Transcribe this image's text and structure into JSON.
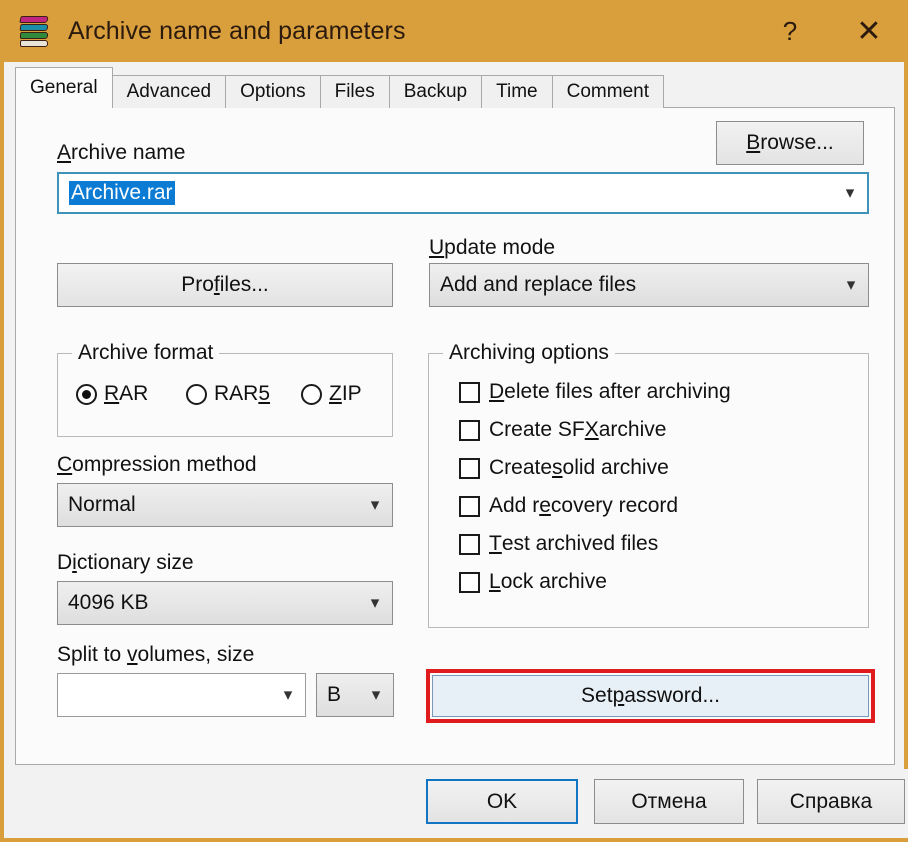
{
  "window": {
    "title": "Archive name and parameters",
    "icon": "winrar-books-icon",
    "help_button": "?",
    "close_button": "✕",
    "titlebar_color": "#d89f3c"
  },
  "tabs": [
    {
      "label": "General",
      "active": true
    },
    {
      "label": "Advanced",
      "active": false
    },
    {
      "label": "Options",
      "active": false
    },
    {
      "label": "Files",
      "active": false
    },
    {
      "label": "Backup",
      "active": false
    },
    {
      "label": "Time",
      "active": false
    },
    {
      "label": "Comment",
      "active": false
    }
  ],
  "general": {
    "archive_name": {
      "label_pre": "A",
      "label_post": "rchive name",
      "value": "Archive.rar",
      "selected": true,
      "focused": true
    },
    "browse_button": {
      "label_pre": "B",
      "label_post": "rowse..."
    },
    "profiles_button": {
      "label_pre_a": "Pro",
      "label_acc": "f",
      "label_post": "iles..."
    },
    "update_mode": {
      "label_pre": "U",
      "label_post": "pdate mode",
      "value": "Add and replace files"
    },
    "archive_format": {
      "legend": "Archive format",
      "options": [
        {
          "label_acc": "R",
          "label_post": "AR",
          "label_pre": "",
          "selected": true
        },
        {
          "label_acc": "5",
          "label_post": "",
          "label_pre": "RAR",
          "selected": false
        },
        {
          "label_acc": "Z",
          "label_post": "IP",
          "label_pre": "",
          "selected": false
        }
      ]
    },
    "compression_method": {
      "label_pre": "C",
      "label_post": "ompression method",
      "value": "Normal"
    },
    "dictionary_size": {
      "label_pre_a": "D",
      "label_acc": "i",
      "label_post": "ctionary size",
      "value": "4096 KB"
    },
    "split_volumes": {
      "label_pre": "Split to ",
      "label_acc": "v",
      "label_post": "olumes, size",
      "value": "",
      "unit_value": "B"
    },
    "archiving_options": {
      "legend": "Archiving options",
      "items": [
        {
          "pre": "",
          "acc": "D",
          "post": "elete files after archiving",
          "checked": false
        },
        {
          "pre": "Create SF",
          "acc": "X",
          "post": " archive",
          "checked": false
        },
        {
          "pre": "Create ",
          "acc": "s",
          "post": "olid archive",
          "checked": false
        },
        {
          "pre": "Add r",
          "acc": "e",
          "post": "covery record",
          "checked": false
        },
        {
          "pre": "",
          "acc": "T",
          "post": "est archived files",
          "checked": false
        },
        {
          "pre": "",
          "acc": "L",
          "post": "ock archive",
          "checked": false
        }
      ]
    },
    "set_password_button": {
      "pre": "Set ",
      "acc": "p",
      "post": "assword...",
      "highlight_color": "#e01b1b",
      "highlighted": true
    }
  },
  "footer": {
    "ok_button": "OK",
    "cancel_button": "Отмена",
    "help_button": "Справка"
  }
}
